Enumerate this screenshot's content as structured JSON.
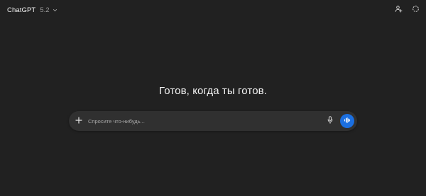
{
  "header": {
    "model_name": "ChatGPT",
    "model_version": "5.2",
    "icons": {
      "model_dropdown": "chevron-down-icon",
      "add_person": "add-person-icon",
      "temporary_chat": "dashed-circle-icon"
    }
  },
  "main": {
    "headline": "Готов, когда ты готов."
  },
  "composer": {
    "placeholder": "Спросите что-нибудь...",
    "value": "",
    "icons": {
      "attach": "plus-icon",
      "dictate": "microphone-icon",
      "voice": "voice-waveform-icon"
    }
  },
  "colors": {
    "background": "#212121",
    "composer_background": "#303030",
    "voice_button": "#1b6fe0",
    "text_primary": "#ececec",
    "text_secondary": "#9a9a9a"
  }
}
